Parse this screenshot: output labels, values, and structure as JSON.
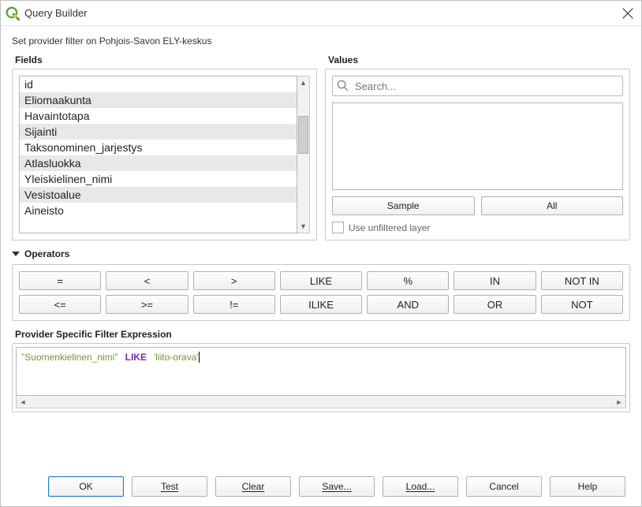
{
  "window": {
    "title": "Query Builder"
  },
  "subtitle": "Set provider filter on Pohjois-Savon ELY-keskus",
  "fields": {
    "label": "Fields",
    "items": [
      "id",
      "Eliomaakunta",
      "Havaintotapa",
      "Sijainti",
      "Taksonominen_jarjestys",
      "Atlasluokka",
      "Yleiskielinen_nimi",
      "Vesistoalue",
      "Aineisto"
    ]
  },
  "values": {
    "label": "Values",
    "search_placeholder": "Search...",
    "sample": "Sample",
    "all": "All",
    "unfiltered": "Use unfiltered layer"
  },
  "operators": {
    "label": "Operators",
    "row1": [
      "=",
      "<",
      ">",
      "LIKE",
      "%",
      "IN",
      "NOT IN"
    ],
    "row2": [
      "<=",
      ">=",
      "!=",
      "ILIKE",
      "AND",
      "OR",
      "NOT"
    ]
  },
  "expression": {
    "label": "Provider Specific Filter Expression",
    "field": "\"Suomenkielinen_nimi\"",
    "keyword": "LIKE",
    "string": "'liito-orava'"
  },
  "footer": {
    "ok": "OK",
    "test": "Test",
    "clear": "Clear",
    "save": "Save...",
    "load": "Load...",
    "cancel": "Cancel",
    "help": "Help"
  }
}
